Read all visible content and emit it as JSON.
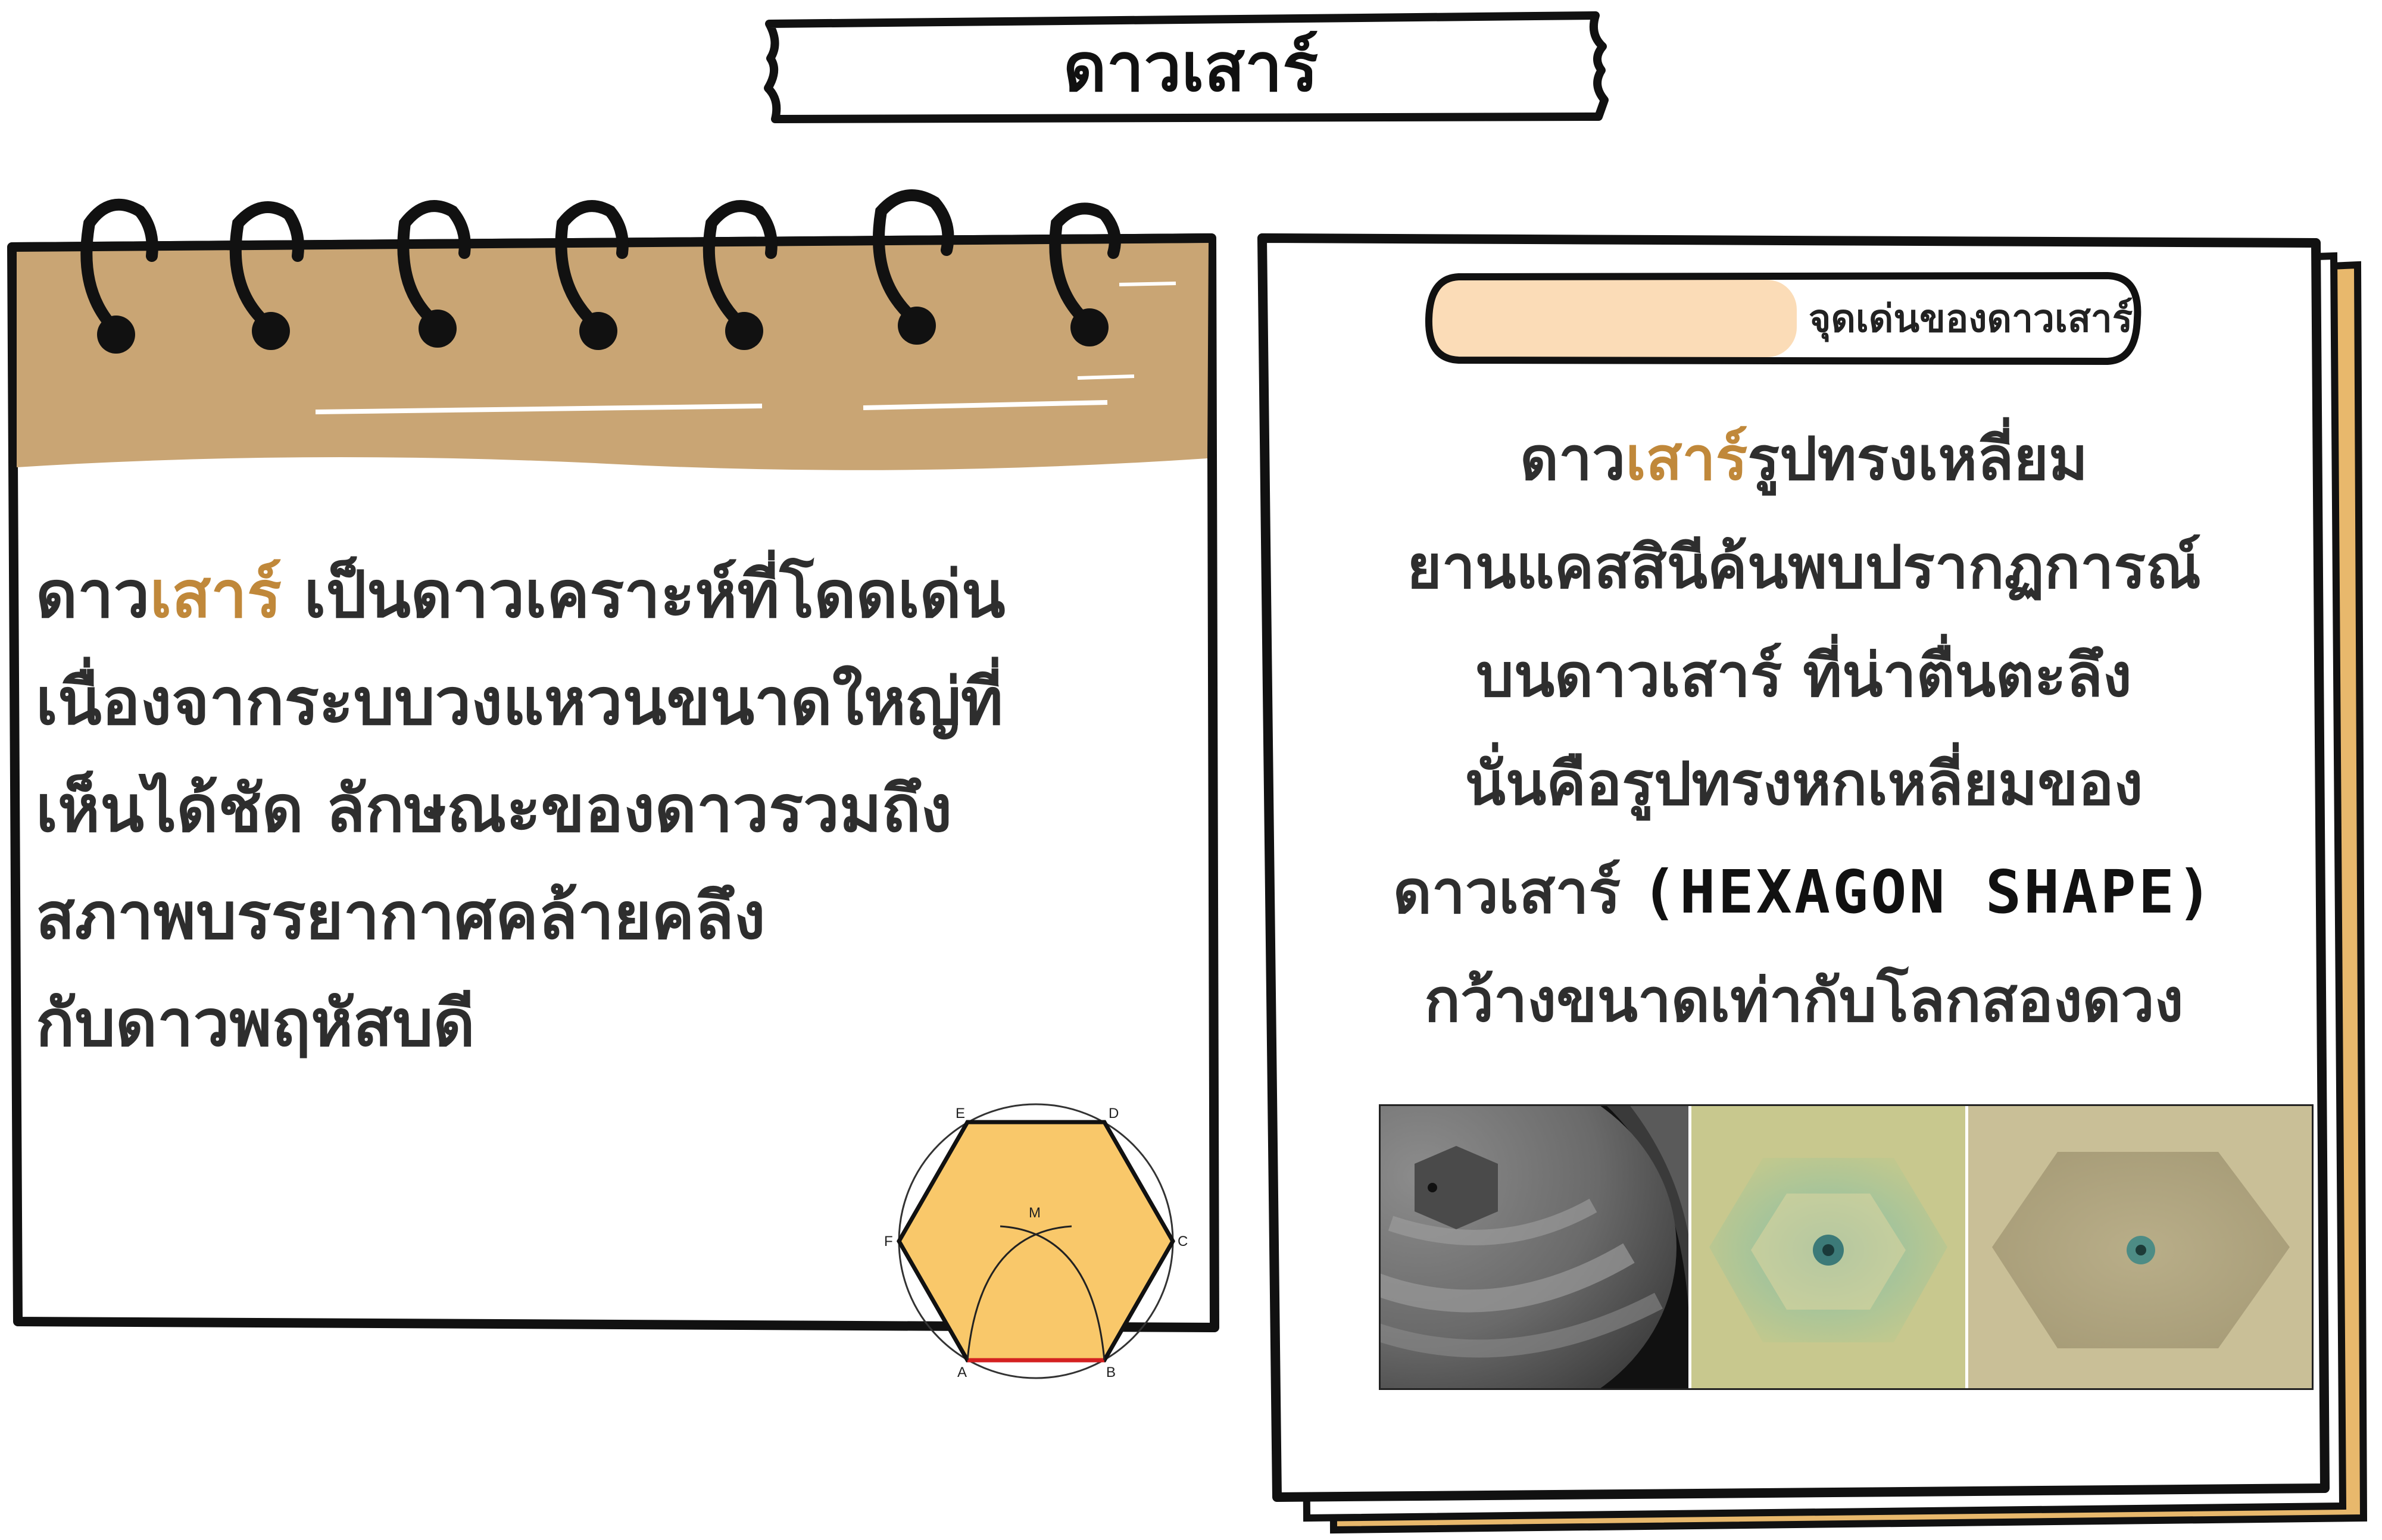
{
  "title": "ดาวเสาร์",
  "left_card": {
    "highlight_word": "เสาร์",
    "lines": [
      {
        "pre": "ดาว",
        "hl": "เสาร์",
        "post": " เป็นดาวเคราะห์ที่โดดเด่น"
      },
      {
        "pre": "เนื่องจากระบบวงแหวนขนาดใหญ่ที่",
        "hl": "",
        "post": ""
      },
      {
        "pre": "เห็นได้ชัด ลักษณะของดาวรวมถึง",
        "hl": "",
        "post": ""
      },
      {
        "pre": "สภาพบรรยากาศคล้ายคลึง",
        "hl": "",
        "post": ""
      },
      {
        "pre": "กับดาวพฤหัสบดี",
        "hl": "",
        "post": ""
      }
    ],
    "figure_labels": {
      "A": "A",
      "B": "B",
      "C": "C",
      "D": "D",
      "E": "E",
      "F": "F",
      "M": "M"
    }
  },
  "right_card": {
    "pill_label": "จุดเด่นของดาวเสาร์",
    "lines": [
      {
        "pre": "ดาว",
        "hl": "เสาร์",
        "post": "รูปทรงเหลี่ยม"
      },
      {
        "pre": "ยานแคสสินีค้นพบปรากฏการณ์",
        "hl": "",
        "post": ""
      },
      {
        "pre": "บนดาวเสาร์ ที่น่าตื่นตะลึง",
        "hl": "",
        "post": ""
      },
      {
        "pre": "นั่นคือรูปทรงหกเหลี่ยมของ",
        "hl": "",
        "post": ""
      },
      {
        "pre": "ดาวเสาร์ ",
        "en": "(HEXAGON SHAPE)",
        "post": ""
      },
      {
        "pre": "กว้างขนาดเท่ากับโลกสองดวง",
        "hl": "",
        "post": ""
      }
    ]
  },
  "colors": {
    "accent": "#c0883a",
    "kraft": "#c9a574",
    "hexagon_fill": "#f9c86a",
    "pill_fill": "#fbdcb7",
    "ink": "#111111"
  }
}
